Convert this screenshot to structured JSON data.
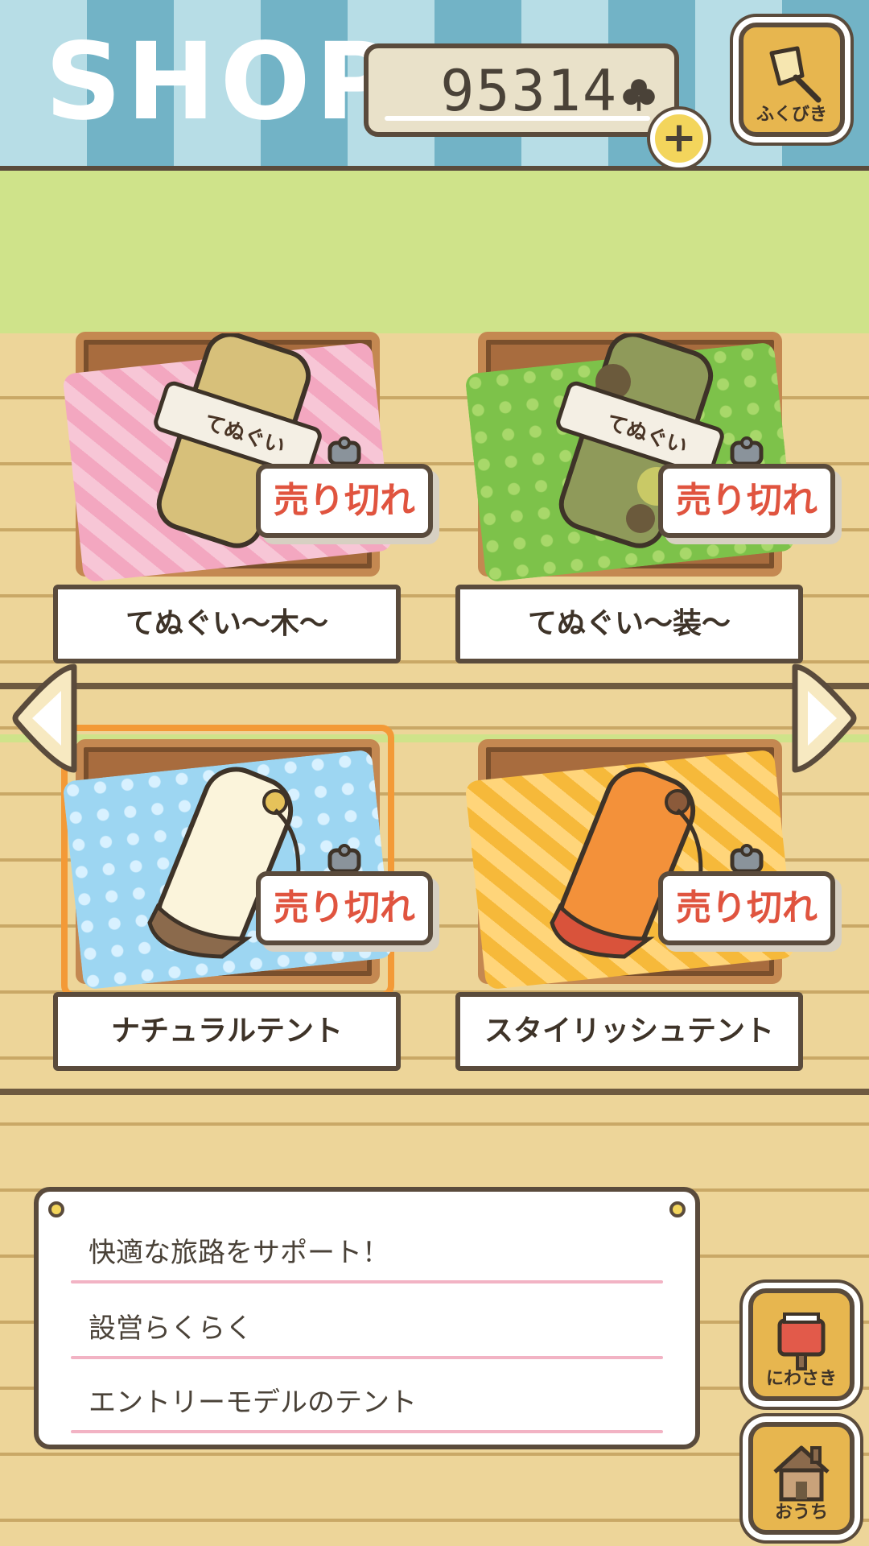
{
  "header": {
    "title": "SHOP",
    "coin_count": "95314",
    "lottery_label": "ふくびき"
  },
  "items": [
    {
      "name": "てぬぐい〜木〜",
      "status": "売り切れ",
      "wrap_label": "てぬぐい"
    },
    {
      "name": "てぬぐい〜装〜",
      "status": "売り切れ",
      "wrap_label": "てぬぐい"
    },
    {
      "name": "ナチュラルテント",
      "status": "売り切れ",
      "selected": true
    },
    {
      "name": "スタイリッシュテント",
      "status": "売り切れ"
    }
  ],
  "description": {
    "lines": [
      "快適な旅路をサポート！",
      "設営らくらく",
      "エントリーモデルのテント"
    ]
  },
  "side_buttons": {
    "garden_label": "にわさき",
    "home_label": "おうち"
  },
  "colors": {
    "sold_out_text": "#e0543f",
    "selected_outline": "#f39a37",
    "coin_button": "#f3d55c"
  }
}
